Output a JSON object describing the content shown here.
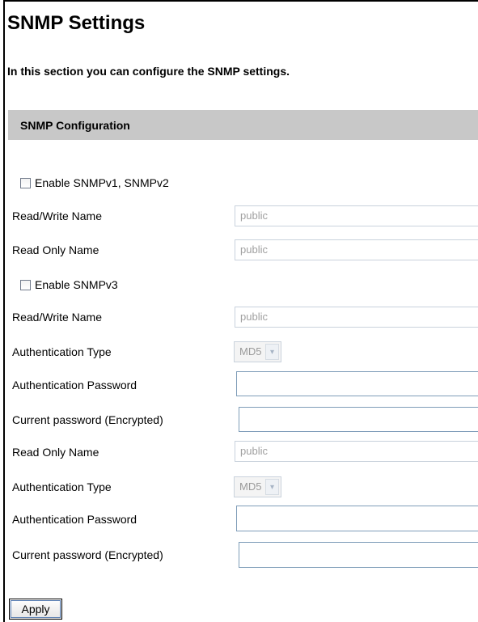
{
  "page": {
    "title": "SNMP Settings",
    "intro": "In this section you can configure the SNMP settings."
  },
  "section": {
    "title": "SNMP Configuration"
  },
  "v1v2": {
    "enable_label": "Enable SNMPv1, SNMPv2",
    "enabled": false,
    "rw_name_label": "Read/Write Name",
    "rw_name_value": "public",
    "ro_name_label": "Read Only Name",
    "ro_name_value": "public"
  },
  "v3": {
    "enable_label": "Enable SNMPv3",
    "enabled": false,
    "rw": {
      "name_label": "Read/Write Name",
      "name_value": "public",
      "auth_type_label": "Authentication Type",
      "auth_type_value": "MD5",
      "auth_password_label": "Authentication Password",
      "auth_password_value": "",
      "current_password_label": "Current password (Encrypted)",
      "current_password_value": ""
    },
    "ro": {
      "name_label": "Read Only Name",
      "name_value": "public",
      "auth_type_label": "Authentication Type",
      "auth_type_value": "MD5",
      "auth_password_label": "Authentication Password",
      "auth_password_value": "",
      "current_password_label": "Current password (Encrypted)",
      "current_password_value": ""
    }
  },
  "actions": {
    "apply_label": "Apply"
  },
  "icons": {
    "select_arrow": "chevron-down-icon"
  }
}
